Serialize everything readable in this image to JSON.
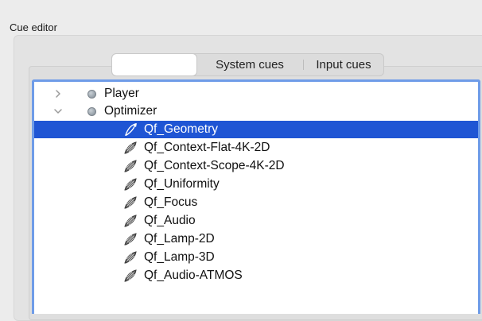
{
  "panel": {
    "title": "Cue editor"
  },
  "tabs": {
    "first_label": "",
    "system_label": "System cues",
    "input_label": "Input cues"
  },
  "tree": {
    "groups": [
      {
        "label": "Player",
        "expanded": false
      },
      {
        "label": "Optimizer",
        "expanded": true
      }
    ],
    "cues": [
      {
        "label": "Qf_Geometry",
        "selected": true
      },
      {
        "label": "Qf_Context-Flat-4K-2D",
        "selected": false
      },
      {
        "label": "Qf_Context-Scope-4K-2D",
        "selected": false
      },
      {
        "label": "Qf_Uniformity",
        "selected": false
      },
      {
        "label": "Qf_Focus",
        "selected": false
      },
      {
        "label": "Qf_Audio",
        "selected": false
      },
      {
        "label": "Qf_Lamp-2D",
        "selected": false
      },
      {
        "label": "Qf_Lamp-3D",
        "selected": false
      },
      {
        "label": "Qf_Audio-ATMOS",
        "selected": false
      }
    ]
  },
  "colors": {
    "selection": "#1f55d4",
    "focus_ring": "#6f9ce8"
  },
  "icons": {
    "collapsed": "chevron-right-icon",
    "expanded": "chevron-down-icon",
    "group": "gray-dot-icon",
    "cue": "cue-icon"
  }
}
